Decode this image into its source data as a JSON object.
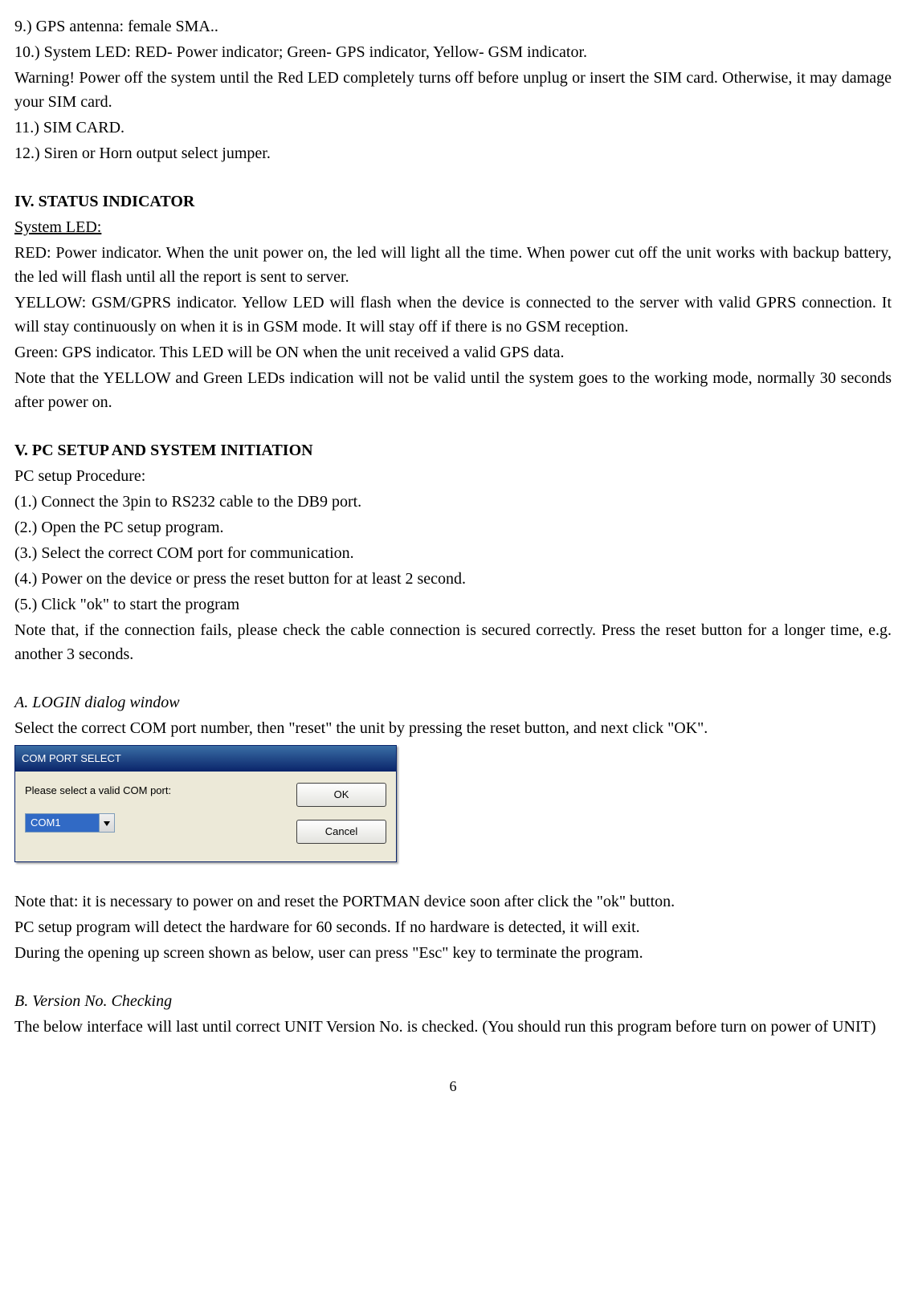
{
  "top_list": {
    "item9": "9.) GPS antenna: female SMA..",
    "item10": "10.) System LED: RED- Power indicator; Green- GPS indicator, Yellow- GSM indicator.",
    "warning": "Warning! Power off the system until the Red LED completely turns off before unplug or insert the SIM card. Otherwise, it may damage your SIM card.",
    "item11": "11.) SIM CARD.",
    "item12": "12.) Siren or Horn output select jumper."
  },
  "section4": {
    "heading": "IV.   STATUS INDICATOR",
    "system_led": "System LED:",
    "red": "RED: Power indicator. When the unit power on, the led will light all the time. When power cut off the unit works with backup battery, the led will flash until all the report is sent to server.",
    "yellow": "YELLOW: GSM/GPRS indicator. Yellow LED will flash when the device is connected to the server with valid GPRS connection. It will stay continuously on when it is in GSM mode. It will stay off if there is no GSM reception.",
    "green": "Green: GPS indicator. This LED will be ON when the unit received a valid GPS data.",
    "note": "Note that the YELLOW and Green LEDs indication will not be valid until the system goes to the working mode, normally 30 seconds after power on."
  },
  "section5": {
    "heading": "V.     PC SETUP AND SYSTEM INITIATION",
    "procedure_label": "PC setup Procedure:",
    "step1": "(1.) Connect the 3pin to RS232 cable to the DB9 port.",
    "step2": "(2.) Open the PC setup program.",
    "step3": "(3.) Select the correct COM port for communication.",
    "step4": "(4.) Power on the device or press the reset button for at least 2 second.",
    "step5": "(5.) Click \"ok\" to start the program",
    "note": "Note that, if the connection fails, please check the cable connection is secured correctly. Press the reset button for a longer time, e.g. another 3 seconds."
  },
  "sectionA": {
    "heading": "A. LOGIN dialog window",
    "instr": "Select the correct COM port number, then \"reset\" the unit by pressing the reset button, and next click \"OK\".",
    "note1": "Note that: it is necessary to power on and reset the PORTMAN device soon after click the \"ok\" button.",
    "note2": "PC setup program will detect the hardware for 60 seconds. If no hardware is detected, it will exit.",
    "note3": "During the opening up screen shown as below, user can press \"Esc\" key to terminate the program."
  },
  "dialog": {
    "title": "COM PORT SELECT",
    "label": "Please select a valid COM port:",
    "combo_value": "COM1",
    "ok": "OK",
    "cancel": "Cancel"
  },
  "sectionB": {
    "heading": "B. Version No. Checking",
    "text": "The below interface will last until correct UNIT Version No. is checked. (You should run this program before turn on power of UNIT)"
  },
  "page_number": "6"
}
